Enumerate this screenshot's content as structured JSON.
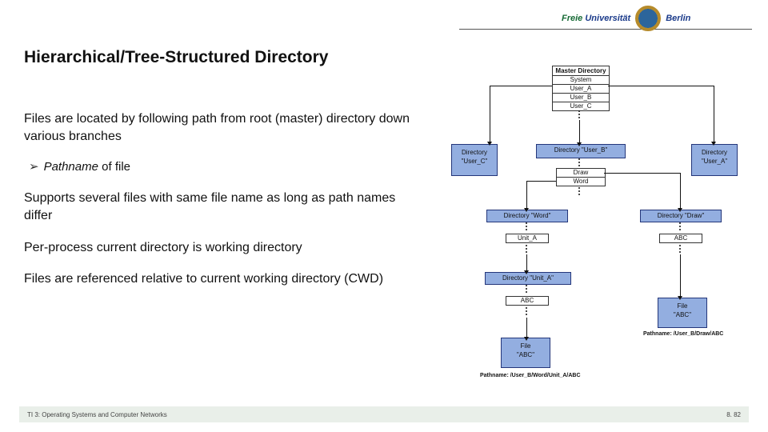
{
  "brand": {
    "free": "Freie",
    "uni": "Universität",
    "city": "Berlin"
  },
  "title": "Hierarchical/Tree-Structured Directory",
  "p1": "Files are located by following path from root (master) directory down various branches",
  "bullet_pathname": "Pathname",
  "bullet_rest": " of file",
  "p2": "Supports several files with same file name as long as path names differ",
  "p3": "Per-process current directory is working directory",
  "p4": "Files are referenced relative to current working directory (CWD)",
  "footer_left": "TI 3: Operating Systems and Computer Networks",
  "footer_right": "8. 82",
  "diag": {
    "master_hdr": "Master Directory",
    "master_rows": [
      "System",
      "User_A",
      "User_B",
      "User_C"
    ],
    "dir_c": "Directory\n\"User_C\"",
    "dir_b": "Directory \"User_B\"",
    "dir_a": "Directory\n\"User_A\"",
    "b_rows": [
      "Draw",
      "Word"
    ],
    "dir_word": "Directory \"Word\"",
    "dir_draw": "Directory \"Draw\"",
    "word_rows": [
      "Unit_A"
    ],
    "draw_rows": [
      "ABC"
    ],
    "dir_unit": "Directory \"Unit_A\"",
    "unit_rows": [
      "ABC"
    ],
    "file_abc1": "File\n\"ABC\"",
    "file_abc2": "File\n\"ABC\"",
    "path1": "Pathname: /User_B/Word/Unit_A/ABC",
    "path2": "Pathname: /User_B/Draw/ABC"
  }
}
